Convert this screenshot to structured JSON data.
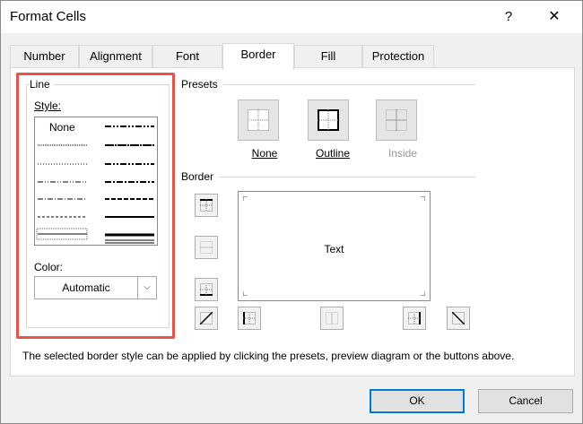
{
  "window": {
    "title": "Format Cells",
    "help": "?",
    "close": "✕"
  },
  "tabs": [
    {
      "label": "Number"
    },
    {
      "label": "Alignment"
    },
    {
      "label": "Font"
    },
    {
      "label": "Border"
    },
    {
      "label": "Fill"
    },
    {
      "label": "Protection"
    }
  ],
  "active_tab": "Border",
  "line": {
    "group_label": "Line",
    "style_label": "Style:",
    "style_none_label": "None",
    "color_label": "Color:",
    "color_value": "Automatic"
  },
  "presets": {
    "group_label": "Presets",
    "none_label": "None",
    "outline_label": "Outline",
    "inside_label": "Inside"
  },
  "border": {
    "group_label": "Border",
    "preview_text": "Text"
  },
  "hint": "The selected border style can be applied by clicking the presets, preview diagram or the buttons above.",
  "buttons": {
    "ok": "OK",
    "cancel": "Cancel"
  },
  "colors": {
    "highlight": "#e8534a",
    "ok_border": "#0078d7"
  }
}
